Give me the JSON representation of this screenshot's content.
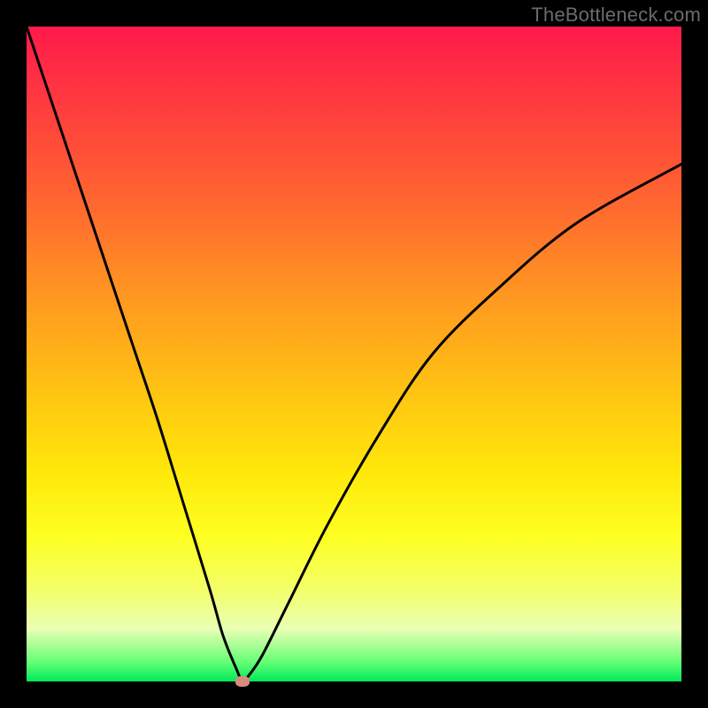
{
  "watermark": "TheBottleneck.com",
  "chart_data": {
    "type": "line",
    "title": "",
    "xlabel": "",
    "ylabel": "",
    "xlim": [
      0,
      100
    ],
    "ylim": [
      0,
      100
    ],
    "background_gradient": {
      "top_color": "#ff1a4b",
      "bottom_color": "#00e85a",
      "meaning": "top = high bottleneck, bottom = no bottleneck"
    },
    "series": [
      {
        "name": "bottleneck-curve",
        "x": [
          0,
          4,
          8,
          12,
          16,
          20,
          24,
          28,
          30,
          32,
          33,
          34,
          36,
          40,
          46,
          54,
          62,
          72,
          84,
          100
        ],
        "y": [
          100,
          88,
          76,
          64,
          52,
          40,
          27,
          14,
          7,
          2,
          0,
          1,
          4,
          12,
          24,
          38,
          50,
          60,
          70,
          79
        ]
      }
    ],
    "marker": {
      "name": "optimal-point",
      "x": 33,
      "y": 0,
      "color": "#d98a7e"
    }
  }
}
